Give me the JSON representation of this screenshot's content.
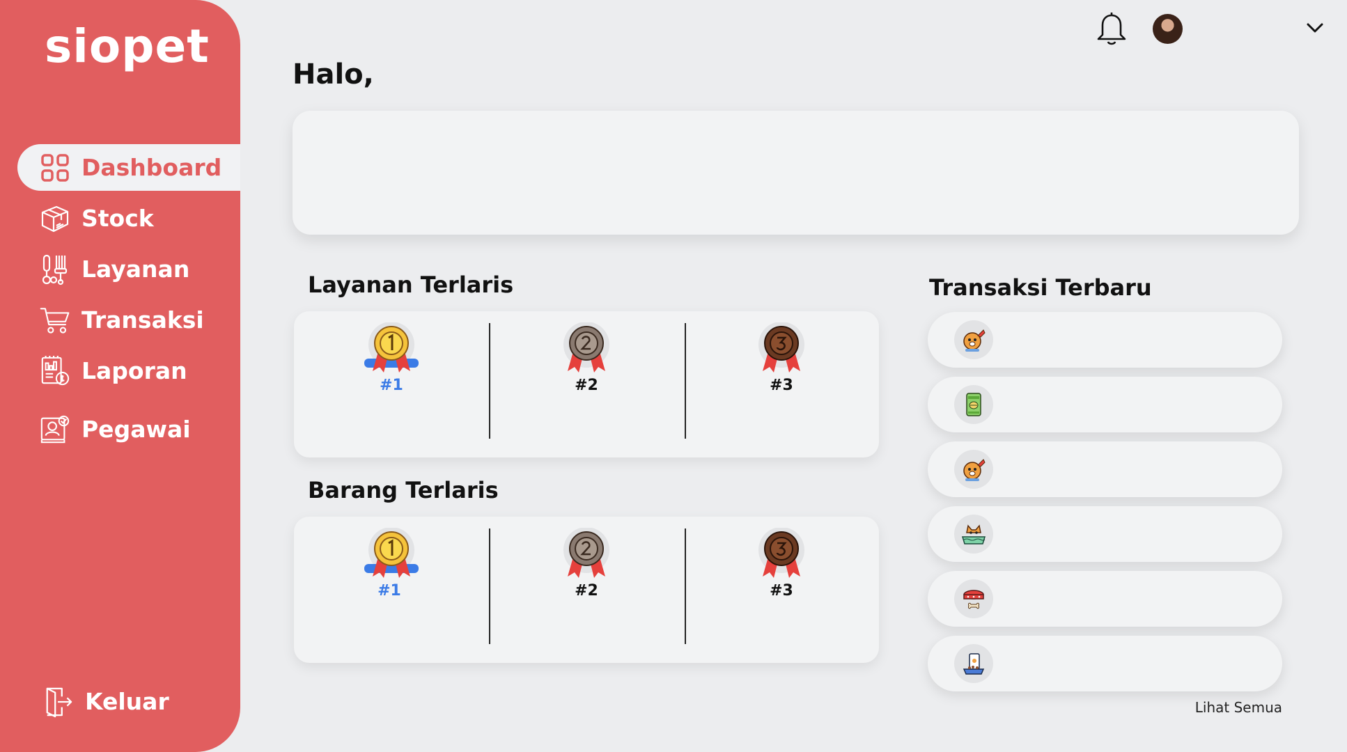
{
  "app": {
    "logo": "siopet"
  },
  "sidebar": {
    "items": [
      {
        "label": "Dashboard",
        "icon": "grid-icon",
        "active": true
      },
      {
        "label": "Stock",
        "icon": "box-icon"
      },
      {
        "label": "Layanan",
        "icon": "grooming-tools-icon"
      },
      {
        "label": "Transaksi",
        "icon": "cart-icon"
      },
      {
        "label": "Laporan",
        "icon": "report-icon"
      },
      {
        "label": "Pegawai",
        "icon": "employee-icon"
      }
    ],
    "logout": {
      "label": "Keluar",
      "icon": "logout-door-icon"
    }
  },
  "header": {
    "notification_icon": "bell-icon",
    "avatar_icon": "user-avatar",
    "menu_icon": "chevron-down-icon"
  },
  "main": {
    "greeting": "Halo,",
    "layanan_terlaris": {
      "title": "Layanan Terlaris",
      "ranks": [
        "#1",
        "#2",
        "#3"
      ]
    },
    "barang_terlaris": {
      "title": "Barang Terlaris",
      "ranks": [
        "#1",
        "#2",
        "#3"
      ]
    },
    "transaksi_terbaru": {
      "title": "Transaksi Terbaru",
      "items": [
        {
          "icon": "dog-grooming-icon"
        },
        {
          "icon": "pet-food-bag-icon"
        },
        {
          "icon": "dog-grooming-icon"
        },
        {
          "icon": "cat-bath-icon"
        },
        {
          "icon": "pet-collar-icon"
        },
        {
          "icon": "pet-food-icon"
        }
      ],
      "see_all": "Lihat Semua"
    }
  },
  "colors": {
    "sidebar": "#E15E5F",
    "background": "#ECEDEF",
    "card": "#F2F3F4",
    "rank_first": "#3B7BE6",
    "gold": "#F5C33B",
    "silver": "#8A7A70",
    "bronze": "#6B3A22"
  }
}
